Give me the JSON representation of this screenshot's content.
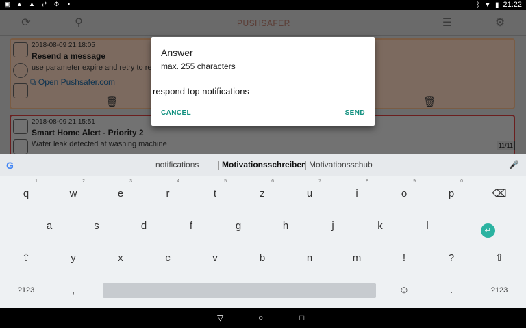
{
  "status": {
    "time": "21:22"
  },
  "toolbar": {
    "logo": "PUSHSAFER"
  },
  "cards": [
    {
      "date": "2018-08-09 21:18:05",
      "title": "Resend a message",
      "desc": "use parameter expire and retry to res",
      "link": "Open Pushsafer.com"
    },
    {
      "date": "2018-08-09 21:15:51",
      "title": "Smart Home Alert - Priority 2",
      "desc": "Water leak detected at washing machine",
      "counter": "11/11"
    }
  ],
  "dialog": {
    "title": "Answer",
    "message": "max. 255 characters",
    "input_value": "respond top notifications",
    "cancel": "CANCEL",
    "send": "SEND"
  },
  "keyboard": {
    "suggestions": [
      "notifications",
      "Motivationsschreiben",
      "Motivationsschub"
    ],
    "row1": [
      "q",
      "w",
      "e",
      "r",
      "t",
      "z",
      "u",
      "i",
      "o",
      "p"
    ],
    "row1_hints": [
      "1",
      "2",
      "3",
      "4",
      "5",
      "6",
      "7",
      "8",
      "9",
      "0"
    ],
    "row2": [
      "a",
      "s",
      "d",
      "f",
      "g",
      "h",
      "j",
      "k",
      "l"
    ],
    "row3": [
      "y",
      "x",
      "c",
      "v",
      "b",
      "n",
      "m",
      "!",
      "?"
    ],
    "symbols_label": "?123",
    "comma": ",",
    "period": "."
  },
  "colors": {
    "accent": "#11907f",
    "enter_key": "#2bb3a1"
  }
}
